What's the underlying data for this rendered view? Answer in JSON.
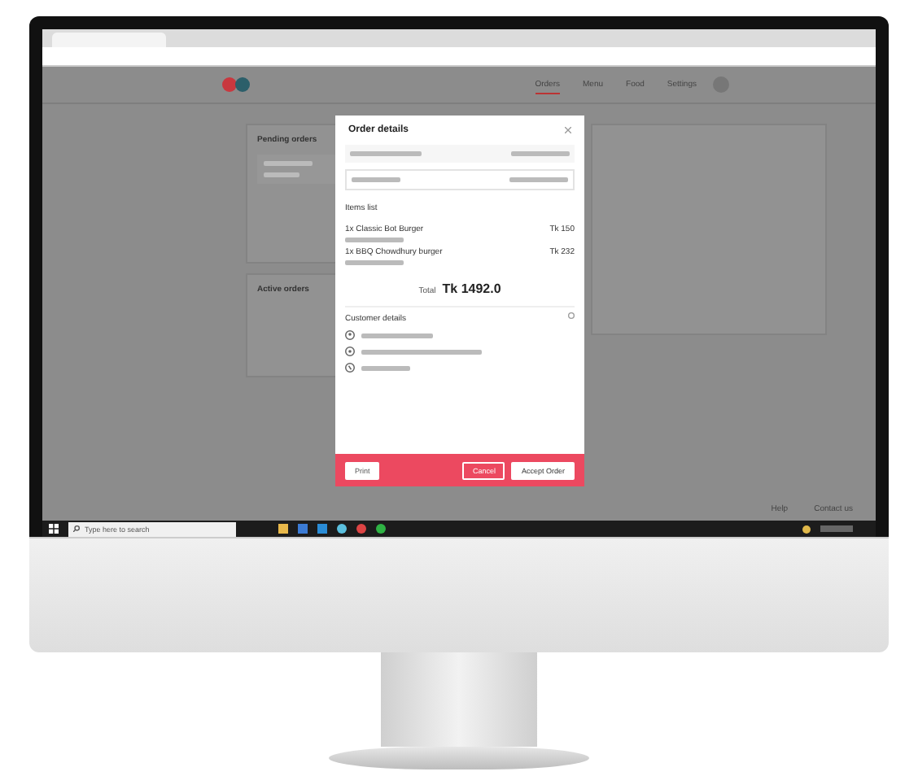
{
  "nav": {
    "items": [
      {
        "label": "Orders",
        "selected": true
      },
      {
        "label": "Menu",
        "selected": false
      },
      {
        "label": "Food",
        "selected": false
      },
      {
        "label": "Settings",
        "selected": false
      }
    ]
  },
  "panels": [
    {
      "title": "Pending orders"
    },
    {
      "title": "Active orders"
    }
  ],
  "modal": {
    "title": "Order details",
    "items_title": "Items list",
    "items": [
      {
        "qty": "1x",
        "name": "Classic Bot Burger",
        "price": "Tk 150"
      },
      {
        "qty": "1x",
        "name": "BBQ Chowdhury burger",
        "price": "Tk 232"
      }
    ],
    "total_label": "Total",
    "total": "Tk 1492.0",
    "customer_title": "Customer details",
    "buttons": [
      {
        "label": "Print",
        "kind": "secondary"
      },
      {
        "label": "Cancel",
        "kind": "outline"
      },
      {
        "label": "Accept Order",
        "kind": "primary"
      }
    ]
  },
  "footer_links": [
    "Help",
    "Contact us"
  ],
  "taskbar": {
    "search_placeholder": "Type here to search"
  }
}
